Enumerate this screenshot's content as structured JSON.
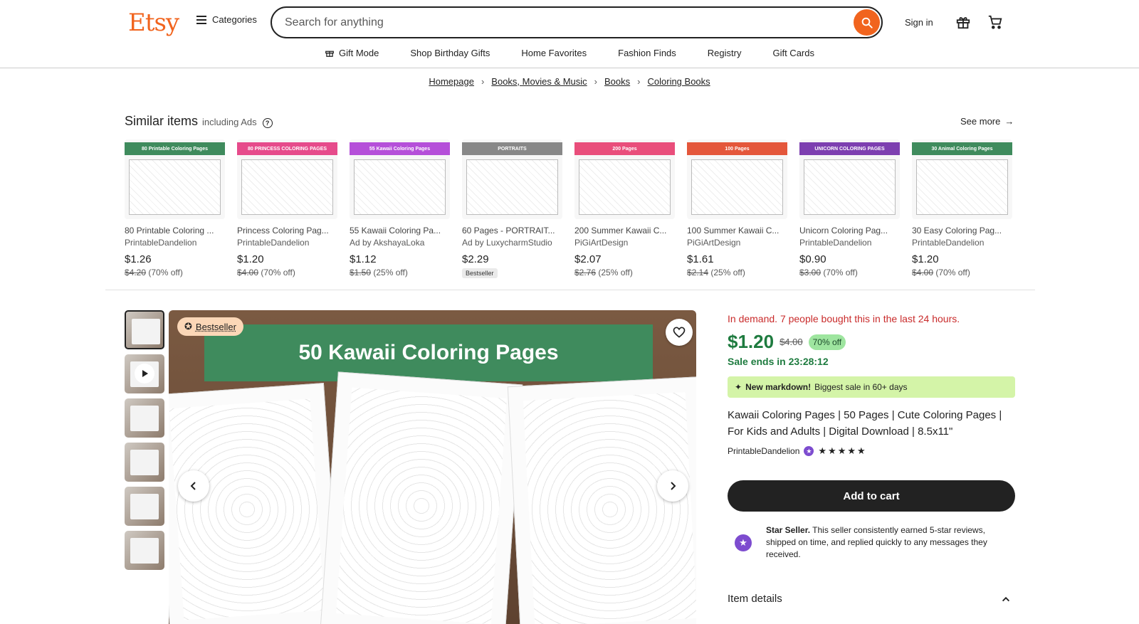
{
  "header": {
    "logo": "Etsy",
    "categories_label": "Categories",
    "search_placeholder": "Search for anything",
    "signin_label": "Sign in"
  },
  "nav": {
    "items": [
      {
        "label": "Gift Mode",
        "icon": "gift-icon"
      },
      {
        "label": "Shop Birthday Gifts"
      },
      {
        "label": "Home Favorites"
      },
      {
        "label": "Fashion Finds"
      },
      {
        "label": "Registry"
      },
      {
        "label": "Gift Cards"
      }
    ]
  },
  "breadcrumb": [
    "Homepage",
    "Books, Movies & Music",
    "Books",
    "Coloring Books"
  ],
  "similar": {
    "title": "Similar items",
    "subtitle": "including Ads",
    "see_more": "See more",
    "items": [
      {
        "banner": "80 Printable Coloring Pages",
        "banner_color": "#3f8b5d",
        "name": "80 Printable Coloring ...",
        "shop": "PrintableDandelion",
        "price": "$1.26",
        "orig": "$4.20",
        "discount": "(70% off)"
      },
      {
        "banner": "80 PRINCESS COLORING PAGES",
        "banner_color": "#e64b8b",
        "name": "Princess Coloring Pag...",
        "shop": "PrintableDandelion",
        "price": "$1.20",
        "orig": "$4.00",
        "discount": "(70% off)"
      },
      {
        "banner": "55 Kawaii Coloring Pages",
        "banner_color": "#b54fd9",
        "name": "55 Kawaii Coloring Pa...",
        "shop": "Ad by AkshayaLoka",
        "price": "$1.12",
        "orig": "$1.50",
        "discount": "(25% off)"
      },
      {
        "banner": "PORTRAITS",
        "banner_color": "#888888",
        "name": "60 Pages - PORTRAIT...",
        "shop": "Ad by LuxycharmStudio",
        "price": "$2.29",
        "orig": "",
        "discount": "",
        "chip": "Bestseller"
      },
      {
        "banner": "200 Pages",
        "banner_color": "#e94e7b",
        "name": "200 Summer Kawaii C...",
        "shop": "PiGiArtDesign",
        "price": "$2.07",
        "orig": "$2.76",
        "discount": "(25% off)"
      },
      {
        "banner": "100 Pages",
        "banner_color": "#e4573b",
        "name": "100 Summer Kawaii C...",
        "shop": "PiGiArtDesign",
        "price": "$1.61",
        "orig": "$2.14",
        "discount": "(25% off)"
      },
      {
        "banner": "UNICORN COLORING PAGES",
        "banner_color": "#7d3fb0",
        "name": "Unicorn Coloring Pag...",
        "shop": "PrintableDandelion",
        "price": "$0.90",
        "orig": "$3.00",
        "discount": "(70% off)"
      },
      {
        "banner": "30 Animal Coloring Pages",
        "banner_color": "#3f8b5d",
        "name": "30 Easy Coloring Pag...",
        "shop": "PrintableDandelion",
        "price": "$1.20",
        "orig": "$4.00",
        "discount": "(70% off)"
      }
    ]
  },
  "gallery": {
    "badge": "Bestseller",
    "main_title": "50 Kawaii Coloring Pages"
  },
  "product": {
    "demand": "In demand. 7 people bought this in the last 24 hours.",
    "price": "$1.20",
    "orig_price": "$4.00",
    "discount": "70% off",
    "sale_ends": "Sale ends in 23:28:12",
    "markdown_bold": "New markdown!",
    "markdown_text": "Biggest sale in 60+ days",
    "title": "Kawaii Coloring Pages | 50 Pages | Cute Coloring Pages | For Kids and Adults | Digital Download | 8.5x11\"",
    "shop": "PrintableDandelion",
    "rating": 5,
    "stars": "★★★★★",
    "add_to_cart": "Add to cart",
    "star_seller_bold": "Star Seller.",
    "star_seller_text": "This seller consistently earned 5-star reviews, shipped on time, and replied quickly to any messages they received.",
    "item_details": "Item details"
  },
  "colors": {
    "brand": "#F1641E",
    "sale_green": "#1e7b3f",
    "demand_red": "#c92b2b",
    "star_purple": "#7d4ccf"
  }
}
